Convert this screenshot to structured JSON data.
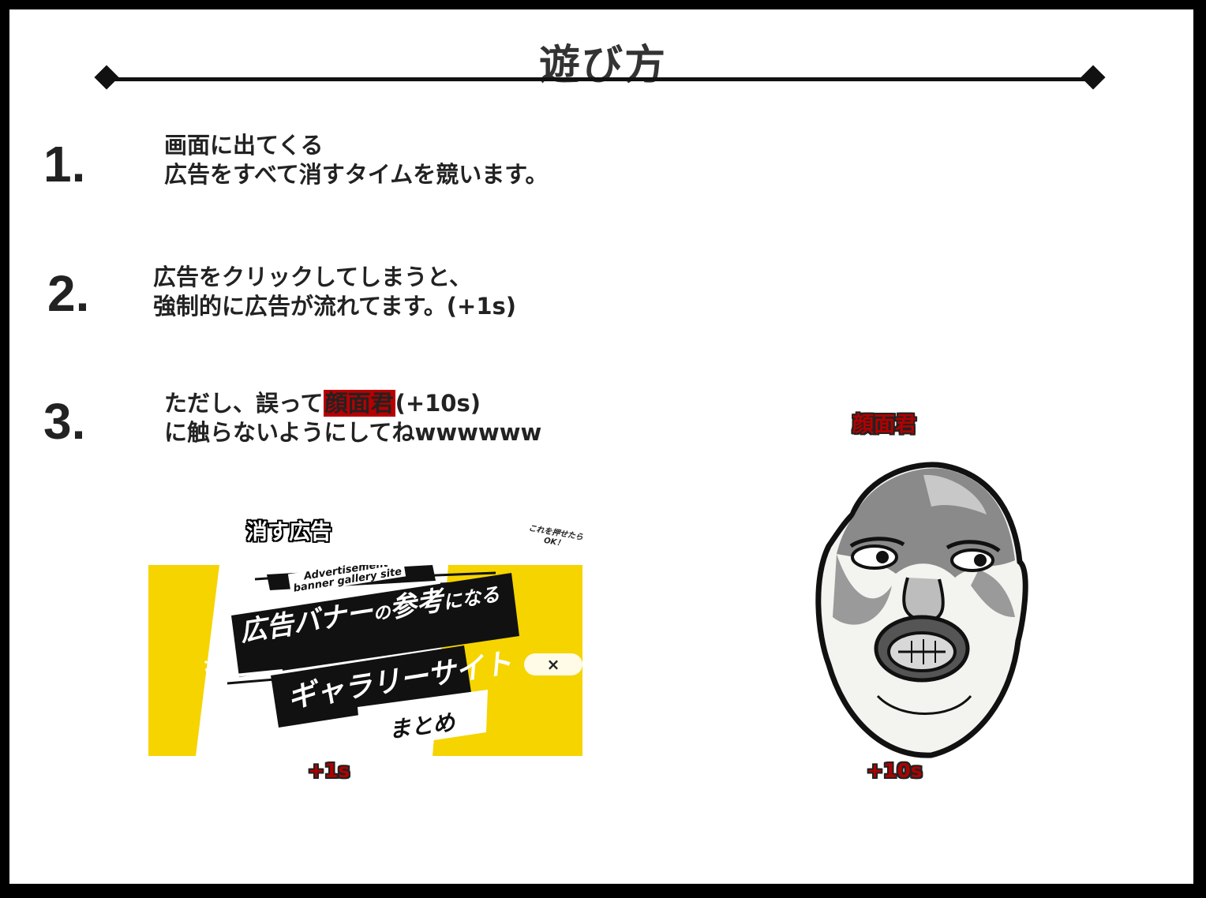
{
  "title": "遊び方",
  "steps": [
    {
      "number": "1.",
      "lines": [
        "画面に出てくる",
        "広告をすべて消すタイムを競います。"
      ]
    },
    {
      "number": "2.",
      "lines": [
        "広告をクリックしてしまうと、",
        "強制的に広告が流れてます。(+1s)"
      ]
    },
    {
      "number": "3.",
      "line1_before": "ただし、誤って",
      "line1_highlight": "顔面君",
      "line1_after": "(+10s)",
      "line2": "に触らないようにしてねwwwwww"
    }
  ],
  "ad_section": {
    "label": "消す広告",
    "hint_line1": "これを押せたら",
    "hint_line2": "OK！",
    "banner": {
      "tag_line1": "Advertisement",
      "tag_line2": "banner gallery site",
      "headline1a": "広告バナー",
      "headline1b": "の",
      "headline1c": "参考",
      "headline1d": "になる",
      "headline2": "ギャラリーサイト",
      "headline3": "まとめ",
      "bg_color": "#f5d400"
    },
    "close_label": "×",
    "penalty": "+1s"
  },
  "face_section": {
    "label": "顔面君",
    "penalty": "+10s",
    "icon": "grimacing-face-illustration"
  },
  "colors": {
    "accent_red": "#b00000",
    "banner_yellow": "#f5d400",
    "frame": "#000000"
  }
}
